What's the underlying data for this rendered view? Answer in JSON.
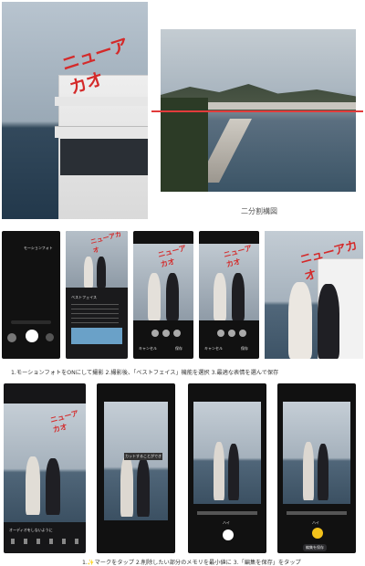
{
  "top": {
    "hotel_sign": "ニューアカオ",
    "diagram_caption": "二分割構図"
  },
  "row1": {
    "screen1_header": "モーションフォト",
    "screen2_title": "ベストフェイス",
    "screen3_cancel": "キャンセル",
    "screen3_save": "保存",
    "screen4_cancel": "キャンセル",
    "screen4_save": "保存",
    "caption": "1.モーションフォトをONにして撮影 2.撮影後、「ベストフェイス」機能を選択 3.最適な表情を選んで保存"
  },
  "row2": {
    "screen1_bottom_label": "オーディオをしないように",
    "screen2_label": "カットすることができ",
    "screen3_label": "ハイ",
    "screen4_label": "ハイ",
    "screen4_save_button": "編集を保存",
    "caption": "1.✨マークをタップ 2.削除したい部分のメモリを最小値に 3.「編集を保存」をタップ"
  },
  "colors": {
    "accent_red": "#d42a2a",
    "accent_yellow": "#f3c21b",
    "sea": "#3b5466"
  }
}
